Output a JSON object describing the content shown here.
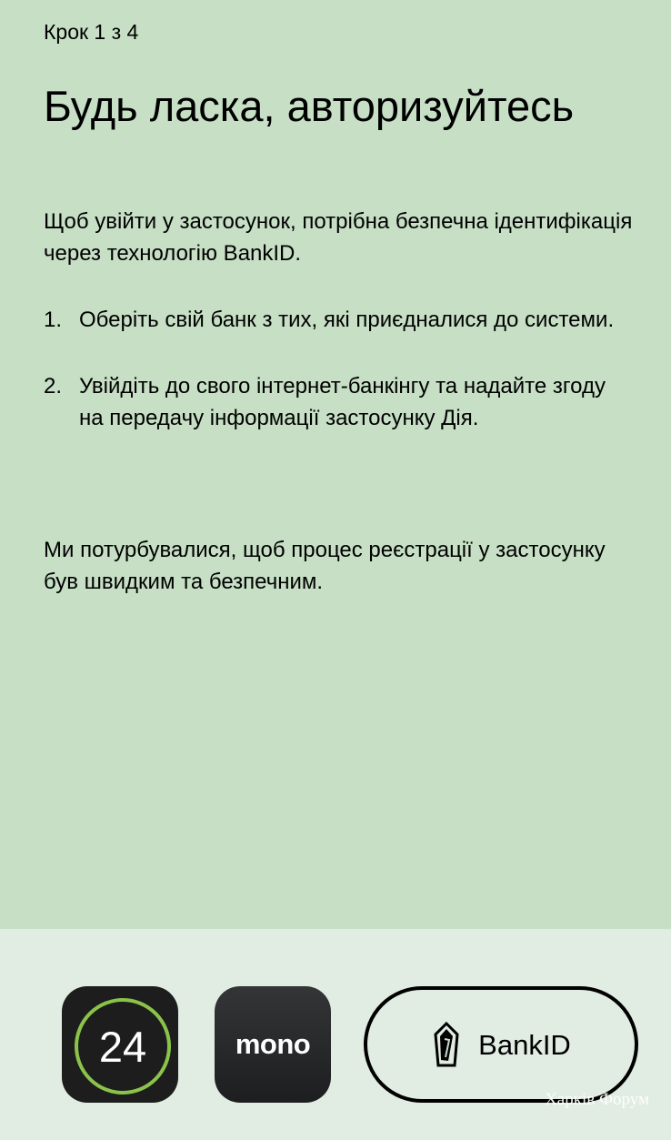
{
  "header": {
    "step_text": "Крок 1 з 4",
    "title": "Будь ласка, авторизуйтесь"
  },
  "main": {
    "intro": "Щоб увійти у застосунок, потрібна безпечна ідентифікація через технологію BankID.",
    "steps": [
      {
        "number": "1.",
        "text": "Оберіть свій банк з тих, які приєдналися до системи."
      },
      {
        "number": "2.",
        "text": "Увійдіть до свого інтернет-банкінгу та надайте згоду на передачу інформації застосунку Дія."
      }
    ],
    "outro": "Ми потурбувалися, щоб процес реєстрації у застосунку був швидким та безпечним."
  },
  "footer": {
    "banks": {
      "privat24": {
        "label": "24",
        "icon": "privat24-logo",
        "ring_color": "#8bc34a",
        "bg_color": "#1c1d1c"
      },
      "mono": {
        "label": "mono",
        "icon": "monobank-logo",
        "bg_color": "#27292b"
      }
    },
    "bankid": {
      "label": "BankID",
      "icon": "bankid-logo"
    }
  },
  "watermark": "Харків Форум",
  "colors": {
    "content_bg": "#c6dfc5",
    "footer_bg": "#e1ece2",
    "text": "#000000"
  }
}
